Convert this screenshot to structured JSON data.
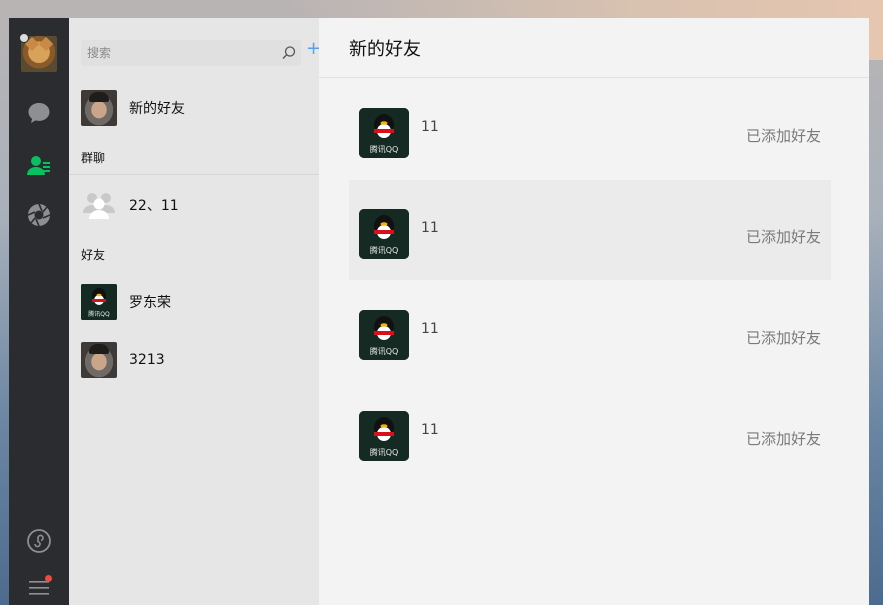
{
  "nav": {
    "items": [
      {
        "icon": "chat-icon"
      },
      {
        "icon": "contacts-icon",
        "active": true
      },
      {
        "icon": "moments-icon"
      },
      {
        "icon": "mini-program-icon"
      },
      {
        "icon": "menu-icon"
      }
    ],
    "active_color": "#07c160"
  },
  "search": {
    "placeholder": "搜索",
    "value": ""
  },
  "contacts": {
    "new_friends": {
      "label": "新的好友"
    },
    "group_section": "群聊",
    "groups": [
      {
        "name": "22、11"
      }
    ],
    "friend_section": "好友",
    "friends": [
      {
        "name": "罗东荣",
        "avatar": "qq-penguin"
      },
      {
        "name": "3213",
        "avatar": "photo"
      }
    ]
  },
  "main": {
    "title": "新的好友",
    "requests": [
      {
        "name": "11",
        "status": "已添加好友"
      },
      {
        "name": "11",
        "status": "已添加好友"
      },
      {
        "name": "11",
        "status": "已添加好友"
      },
      {
        "name": "11",
        "status": "已添加好友"
      }
    ]
  },
  "qq_logo_text": "腾讯QQ"
}
